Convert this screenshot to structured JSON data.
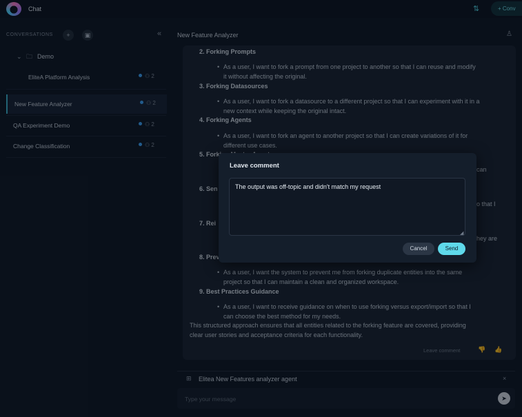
{
  "app": {
    "title": "Chat",
    "new_conversation_label": "+ Conv",
    "top_icon": "⇅"
  },
  "sidebar": {
    "header_label": "CONVERSATIONS",
    "add_icon": "+",
    "folder_icon": "▣",
    "collapse_icon": "«",
    "folder": {
      "chevron": "⌄",
      "icon": "🗀",
      "name": "Demo"
    },
    "conversations": [
      {
        "label": "EliteA Platform Analysis",
        "count": "2"
      },
      {
        "label": "New Feature Analyzer",
        "count": "2",
        "active": true
      },
      {
        "label": "QA Experiment Demo",
        "count": "2"
      },
      {
        "label": "Change Classification",
        "count": "2"
      }
    ],
    "participants_icon": "⚇"
  },
  "main": {
    "title": "New Feature Analyzer",
    "header_icon": "♙",
    "content": {
      "items": [
        {
          "heading": "2. Forking Prompts",
          "lines": [
            "As a user, I want to fork a prompt from one project to another so that I can reuse and modify",
            "it without affecting the original."
          ]
        },
        {
          "heading": "3. Forking Datasources",
          "lines": [
            "As a user, I want to fork a datasource to a different project so that I can experiment with it in a",
            "new context while keeping the original intact."
          ]
        },
        {
          "heading": "4. Forking Agents",
          "lines": [
            "As a user, I want to fork an agent to another project so that I can create variations of it for",
            "different use cases."
          ]
        },
        {
          "heading": "5. Forking Master Agents",
          "lines": [
            "can"
          ]
        },
        {
          "heading": "6. Sen",
          "lines": [
            "o that I"
          ]
        },
        {
          "heading": "7. Rei",
          "lines": [
            "hey are"
          ]
        },
        {
          "heading": "8. Prev",
          "lines": [
            "As a user, I want the system to prevent me from forking duplicate entities into the same",
            "project so that I can maintain a clean and organized workspace."
          ]
        },
        {
          "heading": "9. Best Practices Guidance",
          "lines": [
            "As a user, I want to receive guidance on when to use forking versus export/import so that I",
            "can choose the best method for my needs."
          ]
        }
      ],
      "summary": [
        "This structured approach ensures that all entities related to the forking feature are covered, providing",
        "clear user stories and acceptance criteria for each functionality."
      ],
      "leave_comment": "Leave comment",
      "thumbs_down_icon": "👎",
      "thumbs_up_icon": "👍"
    },
    "agent_bar": {
      "icon": "⊞",
      "name": "Elitea New Features analyzer agent",
      "close_icon": "×"
    },
    "input": {
      "placeholder": "Type your message",
      "send_icon": "➤"
    }
  },
  "modal": {
    "title": "Leave comment",
    "text": "The output was off-topic and didn't match my request",
    "cancel_label": "Cancel",
    "send_label": "Send",
    "resize_icon": "◢"
  }
}
